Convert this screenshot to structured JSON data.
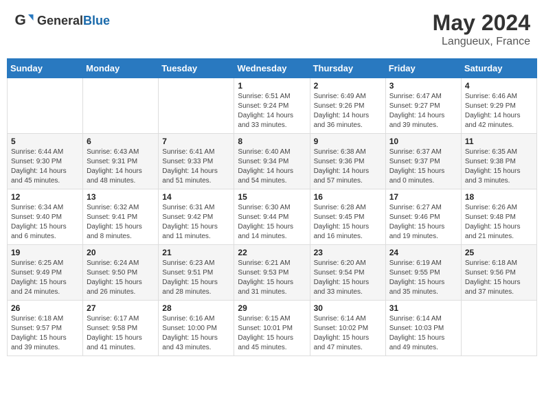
{
  "header": {
    "logo_general": "General",
    "logo_blue": "Blue",
    "month_year": "May 2024",
    "location": "Langueux, France"
  },
  "weekdays": [
    "Sunday",
    "Monday",
    "Tuesday",
    "Wednesday",
    "Thursday",
    "Friday",
    "Saturday"
  ],
  "weeks": [
    [
      {
        "day": "",
        "info": ""
      },
      {
        "day": "",
        "info": ""
      },
      {
        "day": "",
        "info": ""
      },
      {
        "day": "1",
        "info": "Sunrise: 6:51 AM\nSunset: 9:24 PM\nDaylight: 14 hours\nand 33 minutes."
      },
      {
        "day": "2",
        "info": "Sunrise: 6:49 AM\nSunset: 9:26 PM\nDaylight: 14 hours\nand 36 minutes."
      },
      {
        "day": "3",
        "info": "Sunrise: 6:47 AM\nSunset: 9:27 PM\nDaylight: 14 hours\nand 39 minutes."
      },
      {
        "day": "4",
        "info": "Sunrise: 6:46 AM\nSunset: 9:29 PM\nDaylight: 14 hours\nand 42 minutes."
      }
    ],
    [
      {
        "day": "5",
        "info": "Sunrise: 6:44 AM\nSunset: 9:30 PM\nDaylight: 14 hours\nand 45 minutes."
      },
      {
        "day": "6",
        "info": "Sunrise: 6:43 AM\nSunset: 9:31 PM\nDaylight: 14 hours\nand 48 minutes."
      },
      {
        "day": "7",
        "info": "Sunrise: 6:41 AM\nSunset: 9:33 PM\nDaylight: 14 hours\nand 51 minutes."
      },
      {
        "day": "8",
        "info": "Sunrise: 6:40 AM\nSunset: 9:34 PM\nDaylight: 14 hours\nand 54 minutes."
      },
      {
        "day": "9",
        "info": "Sunrise: 6:38 AM\nSunset: 9:36 PM\nDaylight: 14 hours\nand 57 minutes."
      },
      {
        "day": "10",
        "info": "Sunrise: 6:37 AM\nSunset: 9:37 PM\nDaylight: 15 hours\nand 0 minutes."
      },
      {
        "day": "11",
        "info": "Sunrise: 6:35 AM\nSunset: 9:38 PM\nDaylight: 15 hours\nand 3 minutes."
      }
    ],
    [
      {
        "day": "12",
        "info": "Sunrise: 6:34 AM\nSunset: 9:40 PM\nDaylight: 15 hours\nand 6 minutes."
      },
      {
        "day": "13",
        "info": "Sunrise: 6:32 AM\nSunset: 9:41 PM\nDaylight: 15 hours\nand 8 minutes."
      },
      {
        "day": "14",
        "info": "Sunrise: 6:31 AM\nSunset: 9:42 PM\nDaylight: 15 hours\nand 11 minutes."
      },
      {
        "day": "15",
        "info": "Sunrise: 6:30 AM\nSunset: 9:44 PM\nDaylight: 15 hours\nand 14 minutes."
      },
      {
        "day": "16",
        "info": "Sunrise: 6:28 AM\nSunset: 9:45 PM\nDaylight: 15 hours\nand 16 minutes."
      },
      {
        "day": "17",
        "info": "Sunrise: 6:27 AM\nSunset: 9:46 PM\nDaylight: 15 hours\nand 19 minutes."
      },
      {
        "day": "18",
        "info": "Sunrise: 6:26 AM\nSunset: 9:48 PM\nDaylight: 15 hours\nand 21 minutes."
      }
    ],
    [
      {
        "day": "19",
        "info": "Sunrise: 6:25 AM\nSunset: 9:49 PM\nDaylight: 15 hours\nand 24 minutes."
      },
      {
        "day": "20",
        "info": "Sunrise: 6:24 AM\nSunset: 9:50 PM\nDaylight: 15 hours\nand 26 minutes."
      },
      {
        "day": "21",
        "info": "Sunrise: 6:23 AM\nSunset: 9:51 PM\nDaylight: 15 hours\nand 28 minutes."
      },
      {
        "day": "22",
        "info": "Sunrise: 6:21 AM\nSunset: 9:53 PM\nDaylight: 15 hours\nand 31 minutes."
      },
      {
        "day": "23",
        "info": "Sunrise: 6:20 AM\nSunset: 9:54 PM\nDaylight: 15 hours\nand 33 minutes."
      },
      {
        "day": "24",
        "info": "Sunrise: 6:19 AM\nSunset: 9:55 PM\nDaylight: 15 hours\nand 35 minutes."
      },
      {
        "day": "25",
        "info": "Sunrise: 6:18 AM\nSunset: 9:56 PM\nDaylight: 15 hours\nand 37 minutes."
      }
    ],
    [
      {
        "day": "26",
        "info": "Sunrise: 6:18 AM\nSunset: 9:57 PM\nDaylight: 15 hours\nand 39 minutes."
      },
      {
        "day": "27",
        "info": "Sunrise: 6:17 AM\nSunset: 9:58 PM\nDaylight: 15 hours\nand 41 minutes."
      },
      {
        "day": "28",
        "info": "Sunrise: 6:16 AM\nSunset: 10:00 PM\nDaylight: 15 hours\nand 43 minutes."
      },
      {
        "day": "29",
        "info": "Sunrise: 6:15 AM\nSunset: 10:01 PM\nDaylight: 15 hours\nand 45 minutes."
      },
      {
        "day": "30",
        "info": "Sunrise: 6:14 AM\nSunset: 10:02 PM\nDaylight: 15 hours\nand 47 minutes."
      },
      {
        "day": "31",
        "info": "Sunrise: 6:14 AM\nSunset: 10:03 PM\nDaylight: 15 hours\nand 49 minutes."
      },
      {
        "day": "",
        "info": ""
      }
    ]
  ]
}
